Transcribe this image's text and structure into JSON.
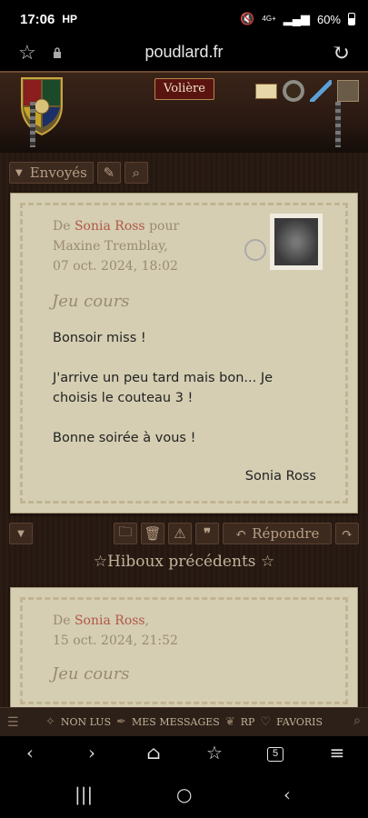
{
  "status": {
    "time": "17:06",
    "carrier_icon": "HP",
    "network": "4G+",
    "battery": "60%"
  },
  "browser": {
    "url": "poudlard.fr"
  },
  "header": {
    "voliere_label": "Volière"
  },
  "toolbar": {
    "folder_label": "Envoyés"
  },
  "letter": {
    "from_prefix": "De",
    "sender": "Sonia Ross",
    "for_word": "pour",
    "recipient": "Maxine Tremblay,",
    "date": "07 oct. 2024, 18:02",
    "subject": "Jeu cours",
    "paragraphs": [
      "Bonsoir miss !",
      "J'arrive un peu tard mais bon... Je choisis le couteau 3 !",
      "Bonne soirée à vous !"
    ],
    "signature": "Sonia Ross"
  },
  "actions": {
    "reply_label": "Répondre"
  },
  "previous": {
    "title": "☆Hiboux précédents ☆",
    "from_prefix": "De",
    "sender": "Sonia Ross",
    "sender_suffix": ",",
    "date": "15 oct. 2024, 21:52",
    "subject": "Jeu cours"
  },
  "sitenav": {
    "non_lus": "NON LUS",
    "mes_messages": "MES MESSAGES",
    "rp": "RP",
    "favoris": "FAVORIS"
  },
  "browsernav": {
    "tab_count": "5"
  },
  "colors": {
    "parchment": "#d5ceb2",
    "sender": "#b05848",
    "voliere_bg": "#5a1410"
  }
}
